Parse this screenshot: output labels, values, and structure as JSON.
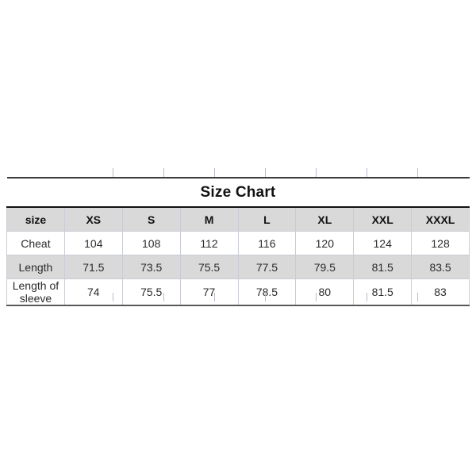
{
  "chart_data": {
    "type": "table",
    "title": "Size Chart",
    "columns": [
      "size",
      "XS",
      "S",
      "M",
      "L",
      "XL",
      "XXL",
      "XXXL"
    ],
    "rows": [
      {
        "label": "Cheat",
        "values": [
          "104",
          "108",
          "112",
          "116",
          "120",
          "124",
          "128"
        ]
      },
      {
        "label": "Length",
        "values": [
          "71.5",
          "73.5",
          "75.5",
          "77.5",
          "79.5",
          "81.5",
          "83.5"
        ]
      },
      {
        "label": "Length of sleeve",
        "values": [
          "74",
          "75.5",
          "77",
          "78.5",
          "80",
          "81.5",
          "83"
        ]
      }
    ],
    "series": [
      {
        "name": "Cheat",
        "values": [
          104,
          108,
          112,
          116,
          120,
          124,
          128
        ]
      },
      {
        "name": "Length",
        "values": [
          71.5,
          73.5,
          75.5,
          77.5,
          79.5,
          81.5,
          83.5
        ]
      },
      {
        "name": "Length of sleeve",
        "values": [
          74,
          75.5,
          77,
          78.5,
          80,
          81.5,
          83
        ]
      }
    ],
    "categories": [
      "XS",
      "S",
      "M",
      "L",
      "XL",
      "XXL",
      "XXXL"
    ],
    "xlabel": "",
    "ylabel": "",
    "grid": true,
    "legend": "none"
  },
  "colors": {
    "page_background": "#ffffff",
    "header_fill": "#d9d9d9",
    "row_shaded_fill": "#d9d9d9",
    "grid_line": "#c9ccd4",
    "heavy_rule": "#111111",
    "text": "#1a1a1a"
  }
}
